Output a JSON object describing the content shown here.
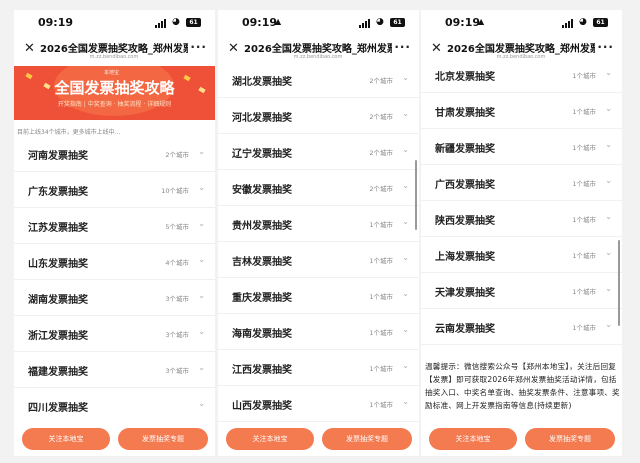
{
  "colors": {
    "accent": "#f47a50",
    "banner": "#ee5138"
  },
  "title_bar": {
    "title": "2026全国发票抽奖攻略_郑州发票中奖",
    "url": "m.zz.bendibao.com",
    "close_icon": "close-icon",
    "more_icon": "more-icon"
  },
  "status": {
    "time": "09:19",
    "battery": "61",
    "icons": [
      "signal-icon",
      "wifi-icon",
      "battery-icon",
      "notification-bell-icon"
    ]
  },
  "banner": {
    "logo": "本地宝",
    "title": "全国发票抽奖攻略",
    "subtitle": "开奖指南 | 中奖查询 · 抽奖流程 · 详细规则"
  },
  "notice": "目前上线34个城市，更多城市上线中...",
  "screens": [
    {
      "items": [
        {
          "title": "河南发票抽奖",
          "count": "2个城市"
        },
        {
          "title": "广东发票抽奖",
          "count": "10个城市"
        },
        {
          "title": "江苏发票抽奖",
          "count": "5个城市"
        },
        {
          "title": "山东发票抽奖",
          "count": "4个城市"
        },
        {
          "title": "湖南发票抽奖",
          "count": "3个城市"
        },
        {
          "title": "浙江发票抽奖",
          "count": "3个城市"
        },
        {
          "title": "福建发票抽奖",
          "count": "3个城市"
        },
        {
          "title": "四川发票抽奖",
          "count": ""
        }
      ]
    },
    {
      "items": [
        {
          "title": "湖北发票抽奖",
          "count": "2个城市"
        },
        {
          "title": "河北发票抽奖",
          "count": "2个城市"
        },
        {
          "title": "辽宁发票抽奖",
          "count": "2个城市"
        },
        {
          "title": "安徽发票抽奖",
          "count": "2个城市"
        },
        {
          "title": "贵州发票抽奖",
          "count": "1个城市"
        },
        {
          "title": "吉林发票抽奖",
          "count": "1个城市"
        },
        {
          "title": "重庆发票抽奖",
          "count": "1个城市"
        },
        {
          "title": "海南发票抽奖",
          "count": "1个城市"
        },
        {
          "title": "江西发票抽奖",
          "count": "1个城市"
        },
        {
          "title": "山西发票抽奖",
          "count": "1个城市"
        }
      ]
    },
    {
      "items": [
        {
          "title": "北京发票抽奖",
          "count": "1个城市"
        },
        {
          "title": "甘肃发票抽奖",
          "count": "1个城市"
        },
        {
          "title": "新疆发票抽奖",
          "count": "1个城市"
        },
        {
          "title": "广西发票抽奖",
          "count": "1个城市"
        },
        {
          "title": "陕西发票抽奖",
          "count": "1个城市"
        },
        {
          "title": "上海发票抽奖",
          "count": "1个城市"
        },
        {
          "title": "天津发票抽奖",
          "count": "1个城市"
        },
        {
          "title": "云南发票抽奖",
          "count": "1个城市"
        }
      ],
      "tip": "温馨提示：微信搜索公众号【郑州本地宝】，关注后回复【发票】即可获取2026年郑州发票抽奖活动详情，包括抽奖入口、中奖名单查询、抽奖发票条件、注意事项、奖励标准、网上开发票指南等信息(持续更新)"
    }
  ],
  "bottom": {
    "follow_label": "关注本地宝",
    "topic_label": "发票抽奖专题"
  }
}
